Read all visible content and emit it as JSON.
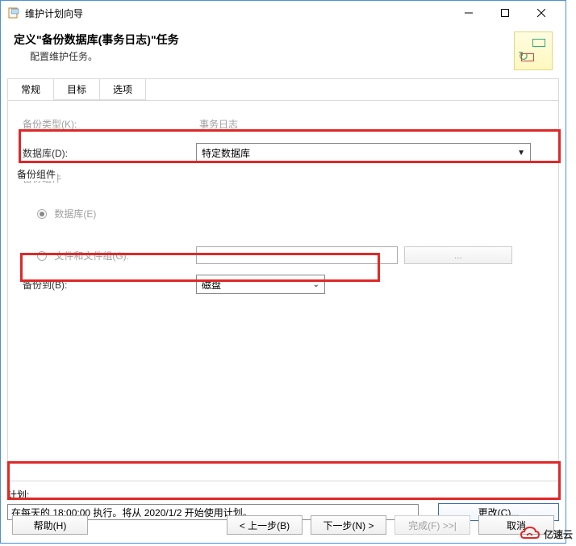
{
  "window": {
    "title": "维护计划向导"
  },
  "header": {
    "title": "定义\"备份数据库(事务日志)\"任务",
    "subtitle": "配置维护任务。"
  },
  "tabs": {
    "general": "常规",
    "target": "目标",
    "options": "选项"
  },
  "form": {
    "backup_type_label": "备份类型(K):",
    "backup_type_value": "事务日志",
    "database_label": "数据库(D):",
    "database_value": "特定数据库",
    "component_label": "备份组件",
    "radio_db": "数据库(E)",
    "radio_files": "文件和文件组(G):",
    "browse_btn": "...",
    "backup_to_label": "备份到(B):",
    "backup_to_value": "磁盘"
  },
  "schedule": {
    "label": "计划:",
    "value": "在每天的 18:00:00 执行。将从 2020/1/2 开始使用计划。",
    "change_btn": "更改(C)..."
  },
  "buttons": {
    "help": "帮助(H)",
    "back": "< 上一步(B)",
    "next": "下一步(N) >",
    "finish": "完成(F) >>|",
    "cancel": "取消"
  },
  "watermark": "亿速云"
}
